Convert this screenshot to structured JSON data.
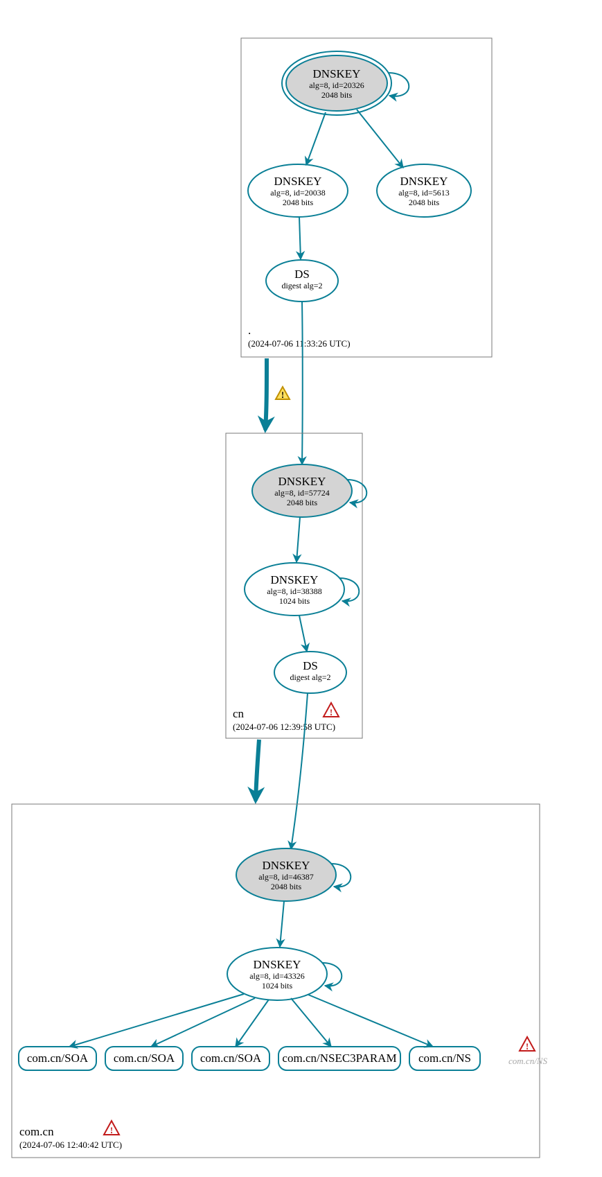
{
  "colors": {
    "stroke": "#0a7f96",
    "ksk_fill": "#d4d4d4",
    "box": "#787878"
  },
  "zones": {
    "root": {
      "label": ".",
      "timestamp": "(2024-07-06 11:33:26 UTC)",
      "nodes": {
        "ksk": {
          "title": "DNSKEY",
          "sub1": "alg=8, id=20326",
          "sub2": "2048 bits"
        },
        "zsk": {
          "title": "DNSKEY",
          "sub1": "alg=8, id=20038",
          "sub2": "2048 bits"
        },
        "zsk2": {
          "title": "DNSKEY",
          "sub1": "alg=8, id=5613",
          "sub2": "2048 bits"
        },
        "ds": {
          "title": "DS",
          "sub1": "digest alg=2"
        }
      }
    },
    "cn": {
      "label": "cn",
      "timestamp": "(2024-07-06 12:39:58 UTC)",
      "nodes": {
        "ksk": {
          "title": "DNSKEY",
          "sub1": "alg=8, id=57724",
          "sub2": "2048 bits"
        },
        "zsk": {
          "title": "DNSKEY",
          "sub1": "alg=8, id=38388",
          "sub2": "1024 bits"
        },
        "ds": {
          "title": "DS",
          "sub1": "digest alg=2"
        }
      }
    },
    "comcn": {
      "label": "com.cn",
      "timestamp": "(2024-07-06 12:40:42 UTC)",
      "nodes": {
        "ksk": {
          "title": "DNSKEY",
          "sub1": "alg=8, id=46387",
          "sub2": "2048 bits"
        },
        "zsk": {
          "title": "DNSKEY",
          "sub1": "alg=8, id=43326",
          "sub2": "1024 bits"
        }
      },
      "rrsets": {
        "soa1": "com.cn/SOA",
        "soa2": "com.cn/SOA",
        "soa3": "com.cn/SOA",
        "nsec3": "com.cn/NSEC3PARAM",
        "ns": "com.cn/NS"
      },
      "faded_ns": "com.cn/NS"
    }
  }
}
